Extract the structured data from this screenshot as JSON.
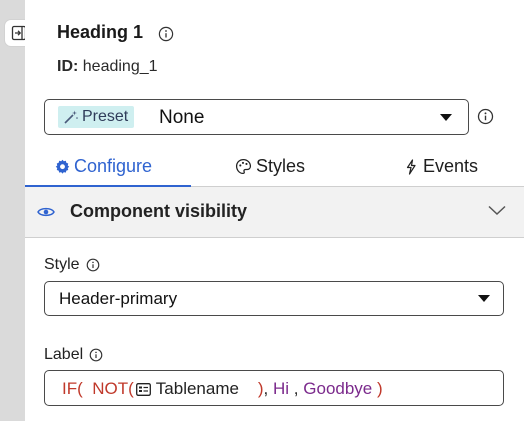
{
  "component": {
    "title": "Heading 1",
    "id_label": "ID:",
    "id_value": "heading_1"
  },
  "preset": {
    "chip_label": "Preset",
    "value": "None"
  },
  "tabs": [
    {
      "label": "Configure",
      "icon": "gear-icon",
      "active": true
    },
    {
      "label": "Styles",
      "icon": "palette-icon",
      "active": false
    },
    {
      "label": "Events",
      "icon": "lightning-icon",
      "active": false
    }
  ],
  "section": {
    "title": "Component visibility",
    "icon": "eye-icon",
    "expanded": false
  },
  "style_field": {
    "label": "Style",
    "value": "Header-primary"
  },
  "label_field": {
    "label": "Label",
    "expression": {
      "fn_if": "IF(",
      "fn_not": "NOT(",
      "ref_name": "Tablename",
      "close_not": ")",
      "comma1": ",",
      "arg_true": "Hi",
      "comma2": ",",
      "arg_false": "Goodbye",
      "close_if": ")"
    }
  },
  "colors": {
    "accent": "#2f63d0",
    "chip_bg": "#cfeff0",
    "keyword": "#c0392b",
    "string": "#7b2a8c"
  }
}
